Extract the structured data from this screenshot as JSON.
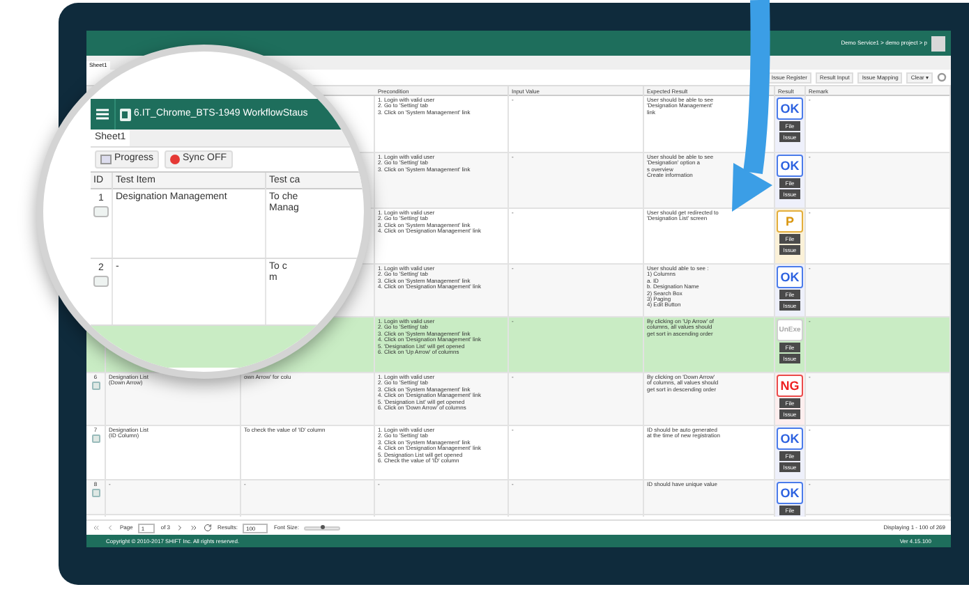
{
  "app_header": {
    "project_path": "Demo Service1 > demo project > p"
  },
  "sheet_tab": {
    "label": "Sheet1",
    "selected": true
  },
  "toolbar_buttons": [
    "Issue Register",
    "Result Input",
    "Issue Mapping",
    "Clear ▾"
  ],
  "table": {
    "columns": [
      "Precondition",
      "Input Value",
      "Expected Result",
      "Result",
      "Remark"
    ],
    "rows": [
      {
        "precondition": "1. Login with valid user\n2. Go to 'Setting' tab\n3. Click on 'System Management' link",
        "input_value": "-",
        "expected": "User should be able to see 'Designation Management' link",
        "result": {
          "label": "OK",
          "kind": "ok"
        },
        "actions": [
          "File",
          "Issue"
        ],
        "remark": "-",
        "highlighted": false
      },
      {
        "precondition": "1. Login with valid user\n2. Go to 'Setting' tab\n3. Click on 'System Management' link",
        "input_value": "-",
        "expected": "User should be able to see 'Designation' option a\ns overview\nCreate information",
        "result": {
          "label": "OK",
          "kind": "ok"
        },
        "actions": [
          "File",
          "Issue"
        ],
        "remark": "-",
        "highlighted": false
      },
      {
        "precondition": "1. Login with valid user\n2. Go to 'Setting' tab\n3. Click on 'System Management' link\n4. Click on 'Designation Management' link",
        "input_value": "-",
        "expected": "User should get redirected to 'Designation List' screen",
        "result": {
          "label": "P",
          "kind": "pending"
        },
        "actions": [
          "File",
          "Issue"
        ],
        "remark": "-",
        "highlighted": false
      },
      {
        "precondition": "1. Login with valid user\n2. Go to 'Setting' tab\n3. Click on 'System Management' link\n4. Click on 'Designation Management' link",
        "input_value": "-",
        "expected": "User should able to see :\n1) Columns\na. ID\nb. Designation Name\n2) Search Box\n3) Paging\n4) Edit Button",
        "result": {
          "label": "OK",
          "kind": "ok"
        },
        "actions": [
          "File",
          "Issue"
        ],
        "remark": "-",
        "highlighted": false
      },
      {
        "precondition": "1. Login with valid user\n2. Go to 'Setting' tab\n3. Click on 'System Management' link\n4. Click on 'Designation Management' link\n5. 'Designation List' will get opened\n6. Click on 'Up Arrow' of columns",
        "input_value": "-",
        "expected": "By clicking on 'Up Arrow' of columns, all values should get sort in ascending order",
        "result": {
          "label": "UnExe",
          "kind": "unexecuted"
        },
        "actions": [
          "File",
          "Issue"
        ],
        "remark": "-",
        "highlighted": true
      },
      {
        "id": "6",
        "test_item": "Designation List\n(Down Arrow)",
        "test_case": "own Arrow' for colu",
        "precondition": "1. Login with valid user\n2. Go to 'Setting' tab\n3. Click on 'System Management' link\n4. Click on 'Designation Management' link\n5. 'Designation List' will get opened\n6. Click on 'Down Arrow' of columns",
        "input_value": "-",
        "expected": "By clicking on 'Down Arrow' of columns, all values should get sort in descending order",
        "result": {
          "label": "NG",
          "kind": "ng"
        },
        "actions": [
          "File",
          "Issue"
        ],
        "remark": "-",
        "highlighted": false
      },
      {
        "id": "7",
        "test_item": "Designation List\n(ID Column)",
        "test_case": "To check the value of 'ID' column",
        "precondition": "1. Login with valid user\n2. Go to 'Setting' tab\n3. Click on 'System Management' link\n4. Click on 'Designation Management' link\n5. Designation List will get opened\n6. Check the value of 'ID' column",
        "input_value": "-",
        "expected": "ID should be auto generated at the time of new registration",
        "result": {
          "label": "OK",
          "kind": "ok"
        },
        "actions": [
          "File",
          "Issue"
        ],
        "remark": "-",
        "highlighted": false
      },
      {
        "id": "8",
        "test_item": "-",
        "test_case": "-",
        "precondition": "-",
        "input_value": "-",
        "expected": "ID should have unique value",
        "result": {
          "label": "OK",
          "kind": "ok"
        },
        "actions": [
          "File"
        ],
        "remark": "-",
        "highlighted": false
      }
    ]
  },
  "pagination": {
    "page_label": "Page",
    "page": "1",
    "of": "of 3",
    "results_label": "Results:",
    "results": "100",
    "font_size_label": "Font Size:",
    "font_size": {
      "level": 0.5
    },
    "displaying": "Displaying 1 - 100 of 269"
  },
  "status_bar": {
    "copyright": "Copyright © 2010-2017 SHIFT Inc. All rights reserved.",
    "version": "Ver 4.15.100"
  },
  "magnifier": {
    "title": "6.IT_Chrome_BTS-1949 WorkflowStaus",
    "sheet_tab": {
      "label": "Sheet1",
      "selected": true
    },
    "buttons": [
      {
        "label": "Progress",
        "kind": "progress"
      },
      {
        "label": "Sync OFF",
        "kind": "sync"
      }
    ],
    "columns": [
      "ID",
      "Test Item",
      "Test ca"
    ],
    "rows": [
      {
        "id": "1",
        "test_item": "Designation Management",
        "test_case": "To che\nManag"
      },
      {
        "id": "2",
        "test_item": "-",
        "test_case": "To c\nm"
      }
    ]
  }
}
